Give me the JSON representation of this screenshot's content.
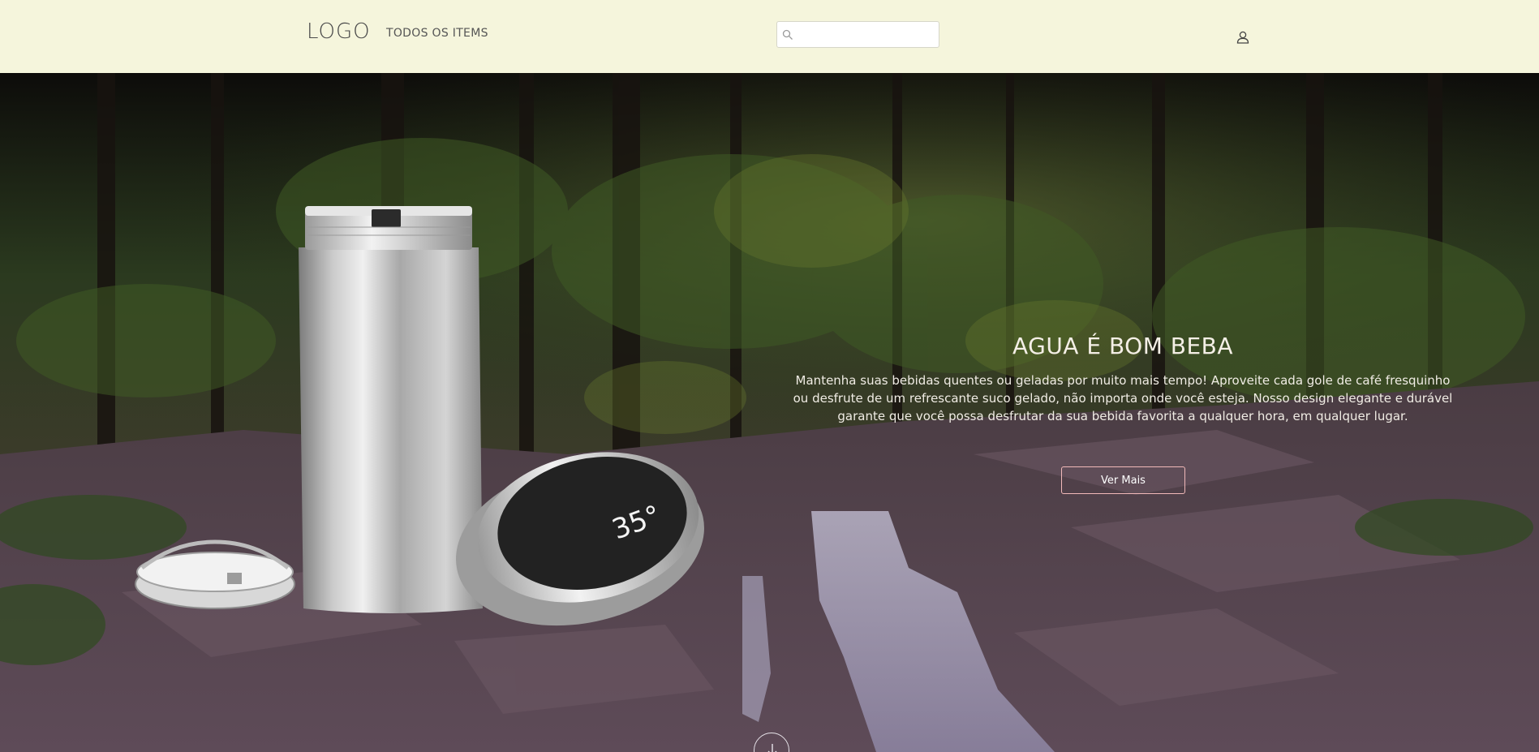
{
  "header": {
    "logo": "LOGO",
    "nav": {
      "all_items": "TODOS OS ITEMS"
    },
    "search": {
      "value": "",
      "placeholder": ""
    },
    "colors": {
      "background": "#f5f5dc"
    }
  },
  "hero": {
    "title": "AGUA É BOM BEBA",
    "description": "Mantenha suas bebidas quentes ou geladas por muito mais tempo! Aproveite cada gole de café fresquinho ou desfrute de um refrescante suco gelado, não importa onde você esteja. Nosso design elegante e durável garante que você possa desfrutar da sua bebida favorita a qualquer hora, em qualquer lugar.",
    "button_label": "Ver Mais",
    "lid_display": "35°",
    "colors": {
      "button_border": "#f1b9b9",
      "text": "#f0ece4"
    }
  },
  "icons": [
    "search-icon",
    "user-icon",
    "scroll-down-icon"
  ]
}
